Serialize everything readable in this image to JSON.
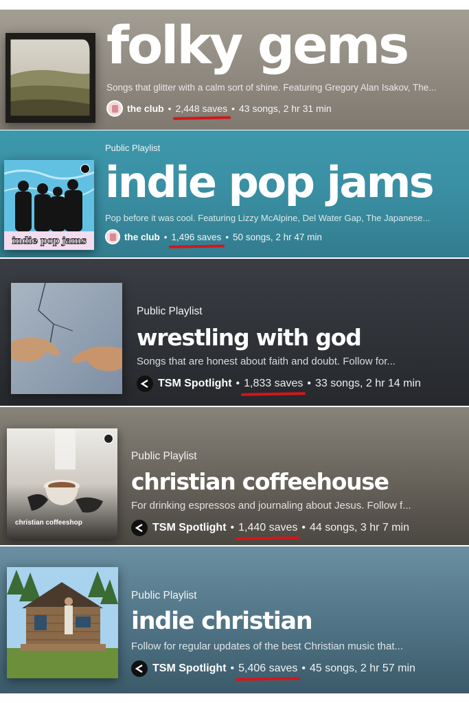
{
  "playlists": [
    {
      "label": "",
      "title": "folky gems",
      "description": "Songs that glitter with a calm sort of shine. Featuring Gregory Alan Isakov, The...",
      "owner": "the club",
      "saves": "2,448 saves",
      "details": "43 songs, 2 hr 31 min"
    },
    {
      "label": "Public Playlist",
      "title": "indie pop jams",
      "description": "Pop before it was cool. Featuring Lizzy McAlpine, Del Water Gap, The Japanese...",
      "owner": "the club",
      "saves": "1,496 saves",
      "details": "50 songs, 2 hr 47 min",
      "cover_text": "indie pop jams"
    },
    {
      "label": "Public Playlist",
      "title": "wrestling with god",
      "description": "Songs that are honest about faith and doubt. Follow for...",
      "owner": "TSM Spotlight",
      "saves": "1,833 saves",
      "details": "33 songs, 2 hr 14 min"
    },
    {
      "label": "Public Playlist",
      "title": "christian coffeehouse",
      "description": "For drinking espressos and journaling about Jesus. Follow f...",
      "owner": "TSM Spotlight",
      "saves": "1,440 saves",
      "details": "44 songs, 3 hr 7 min",
      "cover_text": "christian coffeeshop"
    },
    {
      "label": "Public Playlist",
      "title": "indie christian",
      "description": "Follow for regular updates of the best Christian music that...",
      "owner": "TSM Spotlight",
      "saves": "5,406 saves",
      "details": "45 songs, 2 hr 57 min"
    }
  ],
  "separator": "•",
  "icons": {
    "club_avatar": "pink-square-avatar-icon",
    "tsm_avatar": "tsm-arrow-logo-icon",
    "spotify": "spotify-logo-icon"
  },
  "colors": {
    "underline": "#d4161b",
    "teal": "#3d98ac",
    "dark": "#2f3237"
  }
}
